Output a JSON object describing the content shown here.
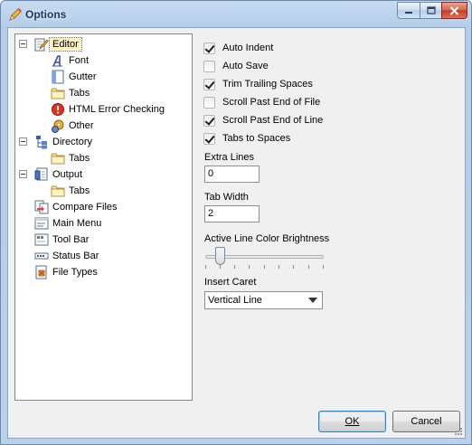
{
  "window": {
    "title": "Options",
    "minimize_glyph": "—",
    "maximize_glyph": "□",
    "close_glyph": "✕"
  },
  "tree": {
    "items": [
      {
        "label": "Editor",
        "icon": "editor-pencil-icon",
        "selected": true,
        "expanded": true
      },
      {
        "label": "Font",
        "icon": "font-icon"
      },
      {
        "label": "Gutter",
        "icon": "gutter-icon"
      },
      {
        "label": "Tabs",
        "icon": "tabs-folder-icon"
      },
      {
        "label": "HTML Error Checking",
        "icon": "error-icon"
      },
      {
        "label": "Other",
        "icon": "other-gear-icon"
      },
      {
        "label": "Directory",
        "icon": "directory-tree-icon",
        "expanded": true
      },
      {
        "label": "Tabs",
        "icon": "tabs-folder-icon"
      },
      {
        "label": "Output",
        "icon": "output-icon",
        "expanded": true
      },
      {
        "label": "Tabs",
        "icon": "tabs-folder-icon"
      },
      {
        "label": "Compare Files",
        "icon": "compare-files-icon"
      },
      {
        "label": "Main Menu",
        "icon": "main-menu-icon"
      },
      {
        "label": "Tool Bar",
        "icon": "tool-bar-icon"
      },
      {
        "label": "Status Bar",
        "icon": "status-bar-icon"
      },
      {
        "label": "File Types",
        "icon": "file-types-icon"
      }
    ]
  },
  "editor": {
    "options": [
      {
        "label": "Auto Indent",
        "checked": true
      },
      {
        "label": "Auto Save",
        "checked": false
      },
      {
        "label": "Trim Trailing Spaces",
        "checked": true
      },
      {
        "label": "Scroll Past End of File",
        "checked": false
      },
      {
        "label": "Scroll Past End of Line",
        "checked": true
      },
      {
        "label": "Tabs to Spaces",
        "checked": true
      }
    ],
    "extra_lines": {
      "label": "Extra Lines",
      "value": "0"
    },
    "tab_width": {
      "label": "Tab Width",
      "value": "2"
    },
    "brightness": {
      "label": "Active Line Color Brightness",
      "level": 0.1
    },
    "caret": {
      "label": "Insert Caret",
      "value": "Vertical Line"
    }
  },
  "buttons": {
    "ok": "OK",
    "cancel": "Cancel"
  },
  "colors": {
    "selection_bg": "#fdf1c4",
    "title_text": "#1e395b",
    "close_red": "#c23c22"
  }
}
